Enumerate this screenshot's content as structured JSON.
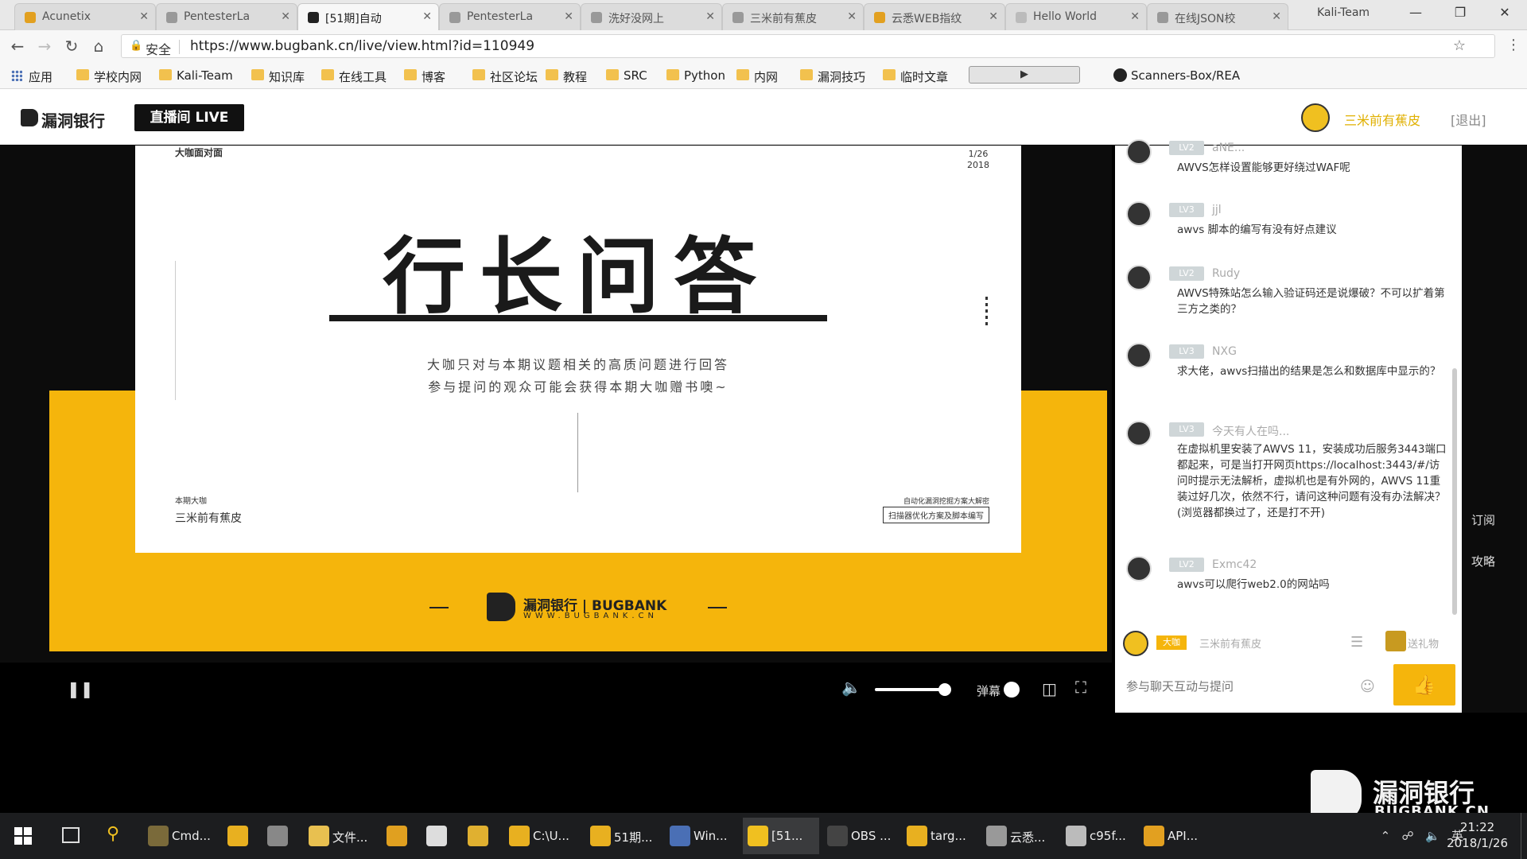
{
  "tabs": [
    {
      "title": "Acunetix",
      "color": "#e2a020"
    },
    {
      "title": "PentesterLa",
      "color": "#999999"
    },
    {
      "title": "[51期]自动",
      "color": "#222222",
      "active": true
    },
    {
      "title": "PentesterLa",
      "color": "#999999"
    },
    {
      "title": "洗好没网上",
      "color": "#999999"
    },
    {
      "title": "三米前有蕉皮",
      "color": "#999999"
    },
    {
      "title": "云悉WEB指纹",
      "color": "#e2a020"
    },
    {
      "title": "Hello World",
      "color": "#bbbbbb"
    },
    {
      "title": "在线JSON校",
      "color": "#999999"
    }
  ],
  "browser": {
    "profile": "Kali-Team",
    "secure_label": "安全",
    "url": "https://www.bugbank.cn/live/view.html?id=110949"
  },
  "bookmarks": [
    {
      "label": "应用",
      "type": "apps"
    },
    {
      "label": "学校内网",
      "type": "folder"
    },
    {
      "label": "Kali-Team",
      "type": "folder"
    },
    {
      "label": "知识库",
      "type": "folder"
    },
    {
      "label": "在线工具",
      "type": "folder"
    },
    {
      "label": "博客",
      "type": "folder"
    },
    {
      "label": "社区论坛",
      "type": "folder"
    },
    {
      "label": "教程",
      "type": "folder"
    },
    {
      "label": "SRC",
      "type": "folder"
    },
    {
      "label": "Python",
      "type": "folder"
    },
    {
      "label": "内网",
      "type": "folder"
    },
    {
      "label": "漏洞技巧",
      "type": "folder"
    },
    {
      "label": "临时文章",
      "type": "folder"
    },
    {
      "label": "Scanners-Box/REA",
      "type": "github"
    }
  ],
  "site": {
    "logo": "漏洞银行",
    "live_badge": "直播间 LIVE",
    "user": "三米前有蕉皮",
    "logout": "[退出]"
  },
  "slide": {
    "corner": "大咖面对面",
    "date_day": "1/26",
    "date_year": "2018",
    "headline": "行长问答",
    "sub1": "大咖只对与本期议题相关的高质问题进行回答",
    "sub2": "参与提问的观众可能会获得本期大咖赠书噢~",
    "host_label": "本期大咖",
    "host_name": "三米前有蕉皮",
    "topic_line": "自动化漏洞挖掘方案大解密",
    "topic_box": "扫描器优化方案及脚本编写",
    "brand_text": "漏洞银行 | BUGBANK",
    "brand_url": "WWW.BUGBANK.CN"
  },
  "player": {
    "danmu_label": "弹幕"
  },
  "chat": {
    "messages": [
      {
        "level": "LV2",
        "name": "aNE...",
        "text": "AWVS怎样设置能够更好绕过WAF呢"
      },
      {
        "level": "LV3",
        "name": "jjl",
        "text": "awvs 脚本的编写有没有好点建议"
      },
      {
        "level": "LV2",
        "name": "Rudy",
        "text": "AWVS特殊站怎么输入验证码还是说爆破？不可以扩着第三方之类的？"
      },
      {
        "level": "LV3",
        "name": "NXG",
        "text": "求大佬，awvs扫描出的结果是怎么和数据库中显示的？"
      },
      {
        "level": "LV3",
        "name": "今天有人在吗...",
        "text": "在虚拟机里安装了AWVS 11，安装成功后服务3443端口都起来，可是当打开网页https://localhost:3443/#/访问时提示无法解析，虚拟机也是有外网的，AWVS 11重装过好几次，依然不行，请问这种问题有没有办法解决？(浏览器都换过了，还是打不开)"
      },
      {
        "level": "LV2",
        "name": "Exmc42",
        "text": "awvs可以爬行web2.0的网站吗"
      }
    ],
    "self_badge": "大咖",
    "self_name": "三米前有蕉皮",
    "gift_label": "送礼物",
    "input_placeholder": "参与聊天互动与提问"
  },
  "side": {
    "subscribe": "订阅",
    "guide": "攻略"
  },
  "watermark": {
    "text": "漏洞银行",
    "url": "BUGBANK.CN"
  },
  "taskbar": {
    "items": [
      {
        "label": "Cmd...",
        "color": "#7a6a3a"
      },
      {
        "label": "",
        "color": "#e8b020"
      },
      {
        "label": "",
        "color": "#888888"
      },
      {
        "label": "文件...",
        "color": "#e8c050"
      },
      {
        "label": "",
        "color": "#e0a020"
      },
      {
        "label": "",
        "color": "#dddddd"
      },
      {
        "label": "",
        "color": "#e0b030"
      },
      {
        "label": "C:\\U...",
        "color": "#e8b020"
      },
      {
        "label": "51期...",
        "color": "#e8b020"
      },
      {
        "label": "Win...",
        "color": "#4a6fb5"
      },
      {
        "label": "[51...",
        "color": "#f0c020",
        "active": true
      },
      {
        "label": "OBS ...",
        "color": "#444444"
      },
      {
        "label": "targ...",
        "color": "#e8b020"
      },
      {
        "label": "云悉...",
        "color": "#999999"
      },
      {
        "label": "c95f...",
        "color": "#bbbbbb"
      },
      {
        "label": "API...",
        "color": "#e2a020"
      }
    ],
    "ime": "英",
    "time": "21:22",
    "date": "2018/1/26"
  }
}
